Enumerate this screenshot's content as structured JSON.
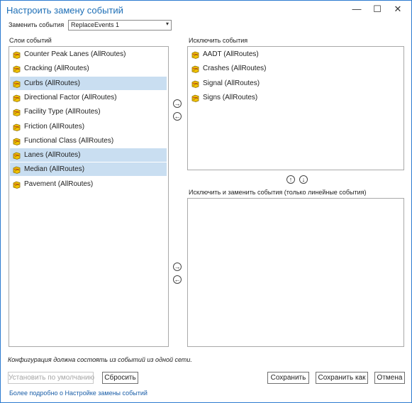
{
  "window": {
    "title": "Настроить замену событий",
    "minimize": "—",
    "maximize": "☐",
    "close": "✕"
  },
  "replace": {
    "label": "Заменить события",
    "value": "ReplaceEvents 1",
    "arrow": "▾"
  },
  "event_layers": {
    "label": "Слои событий",
    "items": [
      {
        "label": "Counter Peak Lanes (AllRoutes)",
        "selected": false
      },
      {
        "label": "Cracking (AllRoutes)",
        "selected": false
      },
      {
        "label": "Curbs (AllRoutes)",
        "selected": true
      },
      {
        "label": "Directional Factor (AllRoutes)",
        "selected": false
      },
      {
        "label": "Facility Type (AllRoutes)",
        "selected": false
      },
      {
        "label": "Friction (AllRoutes)",
        "selected": false
      },
      {
        "label": "Functional Class (AllRoutes)",
        "selected": false
      },
      {
        "label": "Lanes (AllRoutes)",
        "selected": true
      },
      {
        "label": "Median (AllRoutes)",
        "selected": true
      },
      {
        "label": "Pavement (AllRoutes)",
        "selected": false
      }
    ]
  },
  "exclude": {
    "label": "Исключить события",
    "items": [
      {
        "label": "AADT (AllRoutes)"
      },
      {
        "label": "Crashes (AllRoutes)"
      },
      {
        "label": "Signal (AllRoutes)"
      },
      {
        "label": "Signs (AllRoutes)"
      }
    ]
  },
  "exclude_replace": {
    "label": "Исключить и заменить события (только линейные события)"
  },
  "arrows": {
    "right": "→",
    "left": "←",
    "up": "↑",
    "down": "↓"
  },
  "note": "Конфигурация должна состоять из событий из одной сети.",
  "buttons": {
    "set_default": "Установить по умолчанию",
    "reset": "Сбросить",
    "save": "Сохранить",
    "save_as": "Сохранить как",
    "cancel": "Отмена"
  },
  "link": "Более подробно о Настройке замены событий",
  "colors": {
    "title": "#1e6fb6",
    "selection": "#c9def1",
    "icon_fill": "#f2c400",
    "link": "#1a5ea8"
  }
}
